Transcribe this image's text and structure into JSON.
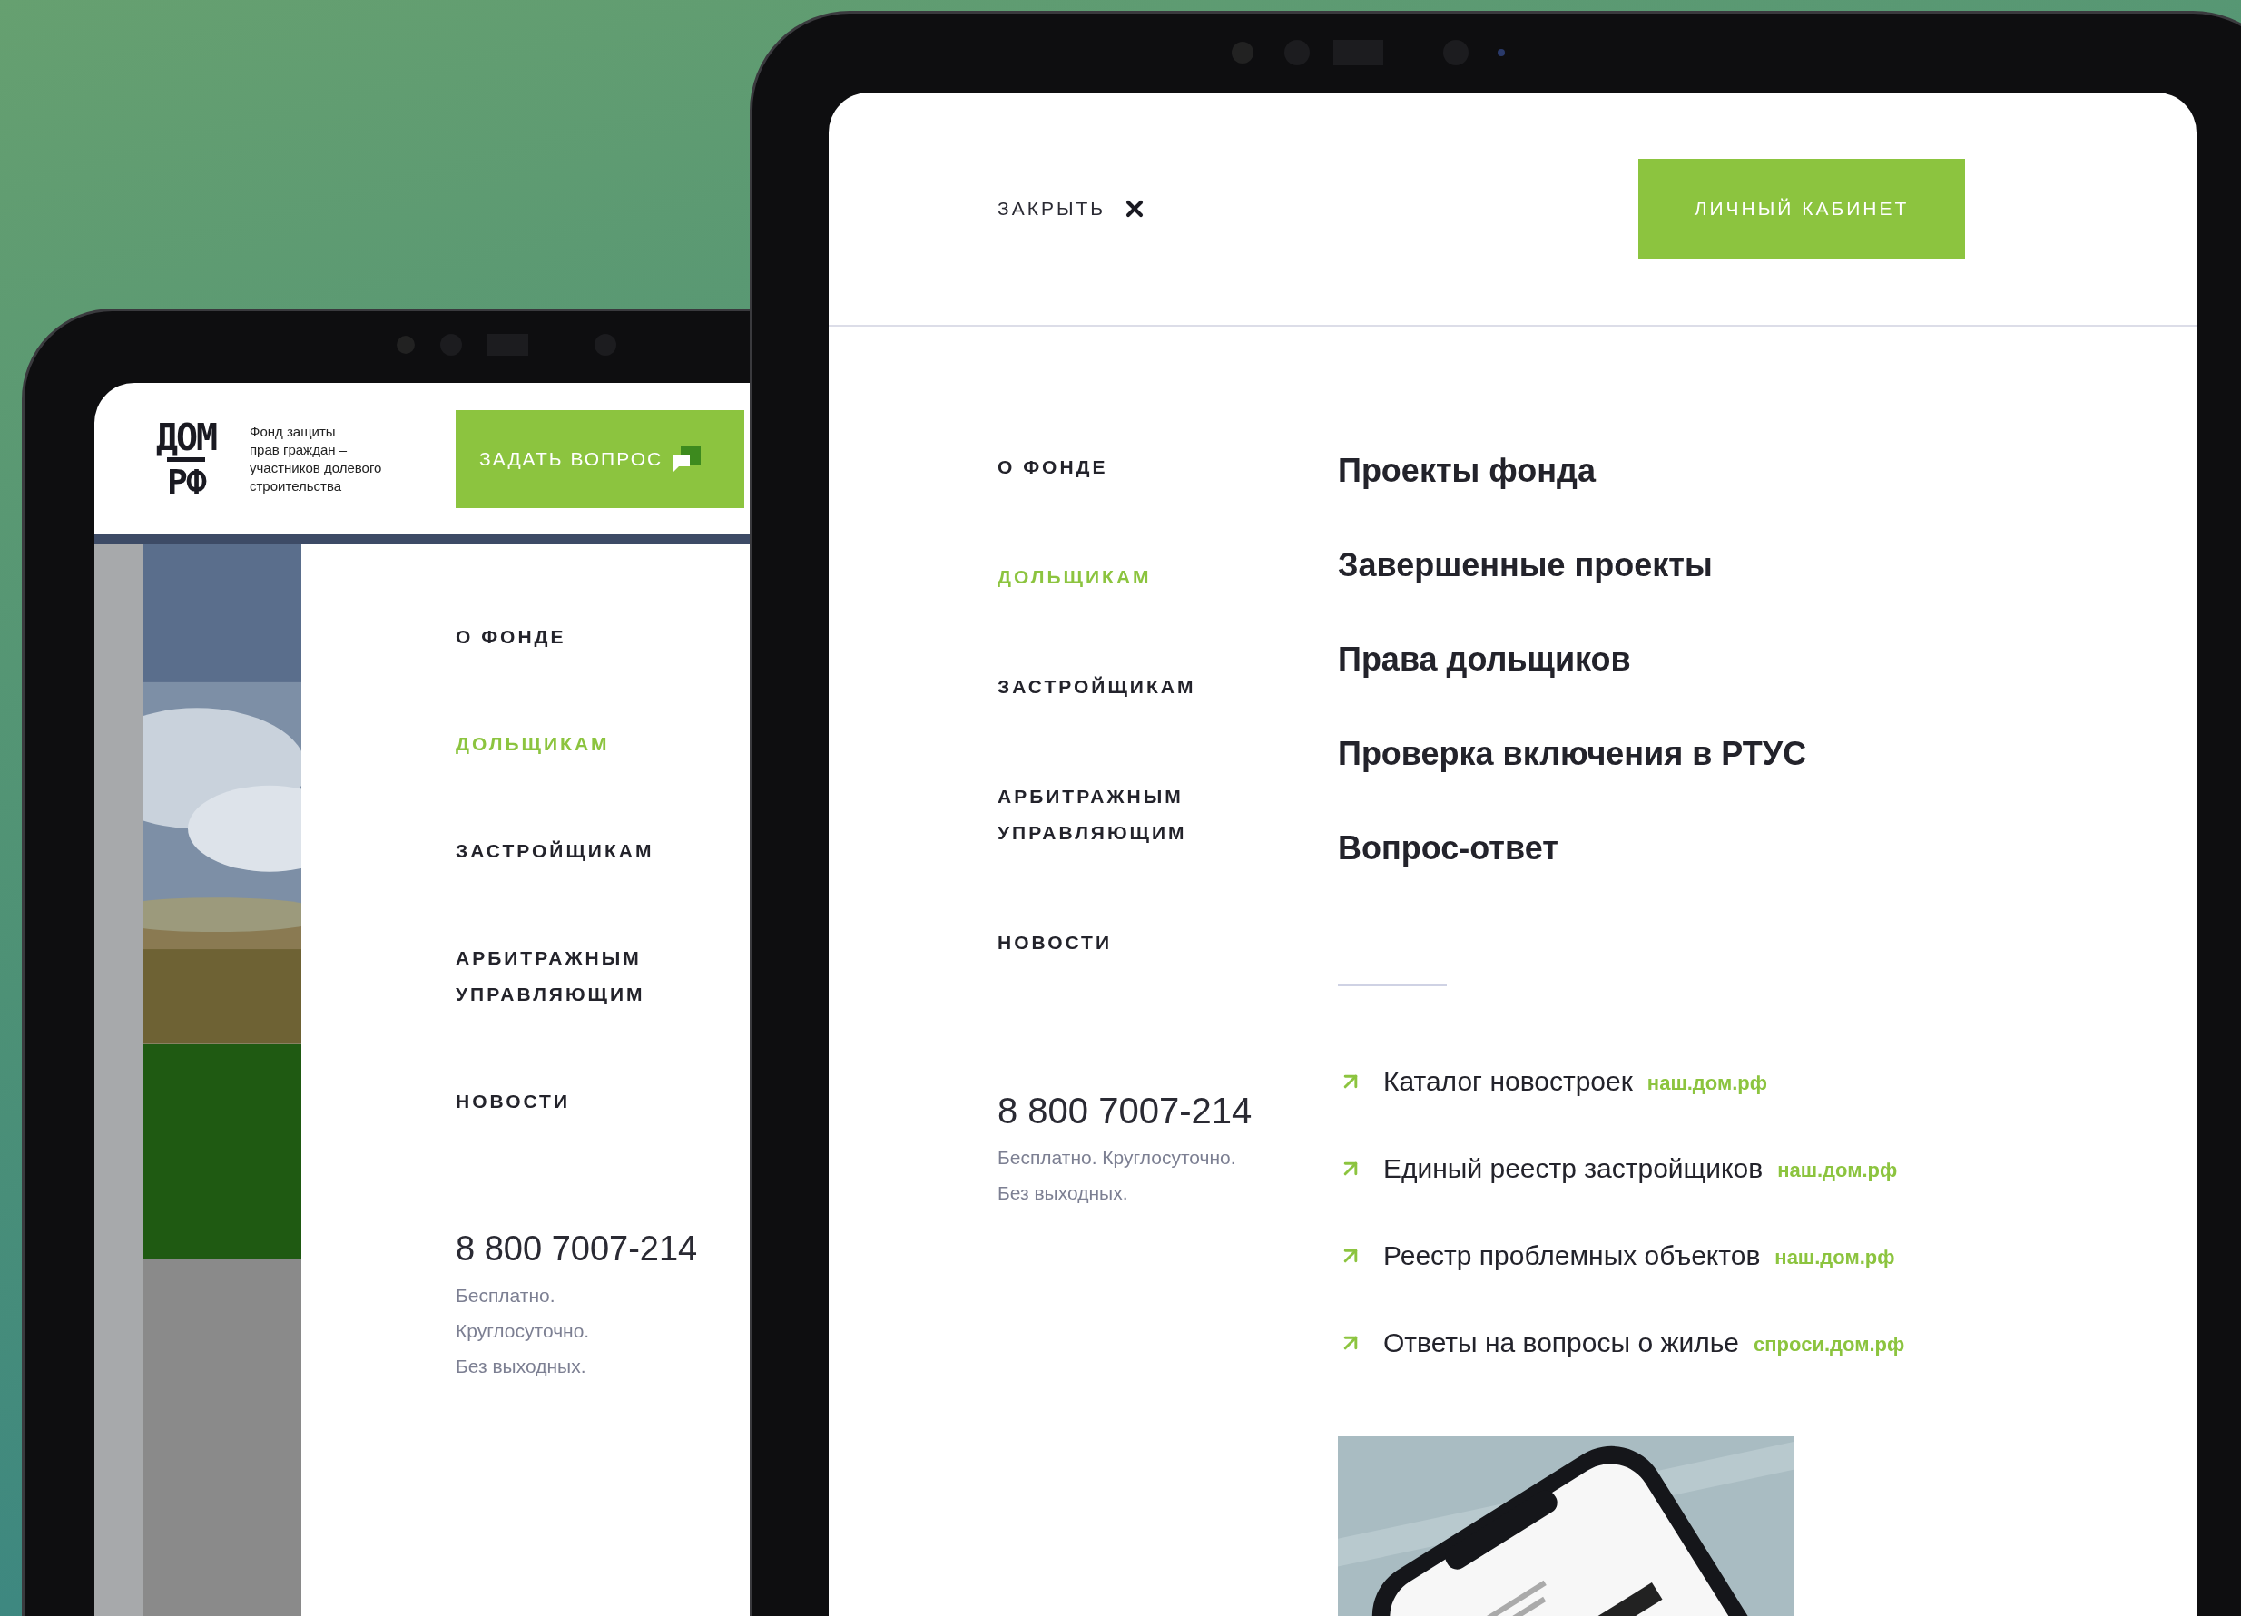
{
  "left_tablet": {
    "logo": {
      "line_1": "ДОМ",
      "line_2": "РФ",
      "org_name": [
        "Фонд защиты",
        "прав граждан –",
        "участников долевого",
        "строительства"
      ]
    },
    "header_button": "ЗАДАТЬ ВОПРОС",
    "menu": [
      {
        "label": "О ФОНДЕ",
        "selected": false
      },
      {
        "label": "ДОЛЬЩИКАМ",
        "selected": true
      },
      {
        "label": "ЗАСТРОЙЩИКАМ",
        "selected": false
      },
      {
        "label": "АРБИТРАЖНЫМ УПРАВЛЯЮЩИМ",
        "selected": false
      },
      {
        "label": "НОВОСТИ",
        "selected": false
      }
    ],
    "phone": "8 800 7007-214",
    "phone_note": [
      "Бесплатно.",
      "Круглосуточно.",
      "Без выходных."
    ]
  },
  "right_tablet": {
    "close": "ЗАКРЫТЬ",
    "account_button": "ЛИЧНЫЙ КАБИНЕТ",
    "menu": [
      {
        "label": "О ФОНДЕ",
        "selected": false
      },
      {
        "label": "ДОЛЬЩИКАМ",
        "selected": true
      },
      {
        "label": "ЗАСТРОЙЩИКАМ",
        "selected": false
      },
      {
        "label": "АРБИТРАЖНЫМ УПРАВЛЯЮЩИМ",
        "selected": false
      },
      {
        "label": "НОВОСТИ",
        "selected": false
      }
    ],
    "submenu": [
      "Проекты фонда",
      "Завершенные проекты",
      "Права дольщиков",
      "Проверка включения в РТУС",
      "Вопрос-ответ"
    ],
    "phone": "8 800 7007-214",
    "phone_note": [
      "Бесплатно. Круглосуточно.",
      "Без выходных."
    ],
    "links": [
      {
        "title": "Каталог новостроек",
        "domain": "наш.дом.рф"
      },
      {
        "title": "Единый реестр застройщиков",
        "domain": "наш.дом.рф"
      },
      {
        "title": "Реестр проблемных объектов",
        "domain": "наш.дом.рф"
      },
      {
        "title": "Ответы на вопросы о жилье",
        "domain": "спроси.дом.рф"
      }
    ],
    "promo": {
      "kind": "picture"
    }
  }
}
